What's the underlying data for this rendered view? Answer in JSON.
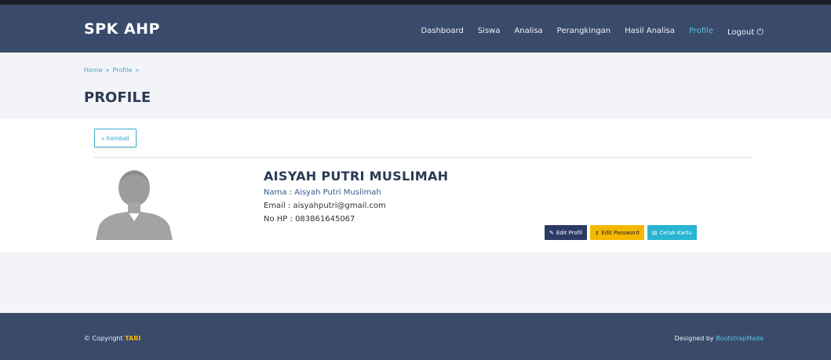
{
  "navbar": {
    "brand": "SPK AHP",
    "items": [
      {
        "label": "Dashboard",
        "active": false
      },
      {
        "label": "Siswa",
        "active": false
      },
      {
        "label": "Analisa",
        "active": false
      },
      {
        "label": "Perangkingan",
        "active": false
      },
      {
        "label": "Hasil Analisa",
        "active": false
      },
      {
        "label": "Profile",
        "active": true
      },
      {
        "label": "Logout",
        "active": false
      }
    ]
  },
  "breadcrumb": [
    "Home",
    "Profile"
  ],
  "page_title": "PROFILE",
  "back_button_label": "« Kembali",
  "profile": {
    "name": "AISYAH PUTRI MUSLIMAH",
    "name_label": "Nama",
    "name_value": "Aisyah Putri Muslimah",
    "email_label": "Email",
    "email_value": "aisyahputri@gmail.com",
    "phone_label": "No HP",
    "phone_value": "083861645067"
  },
  "actions": {
    "edit_label": "Edit Profil",
    "password_label": "Edit Password",
    "card_label": "Cetak Kartu"
  },
  "footer": {
    "copyright_prefix": "© Copyright",
    "copyright_brand": "TARI",
    "designed_prefix": "Designed by",
    "designed_author": "BootstrapMade"
  },
  "colors": {
    "navbar": "#3a4a6b",
    "accent": "#5bc0de",
    "warning": "#f5b800",
    "primary_dark": "#2c3a66"
  }
}
